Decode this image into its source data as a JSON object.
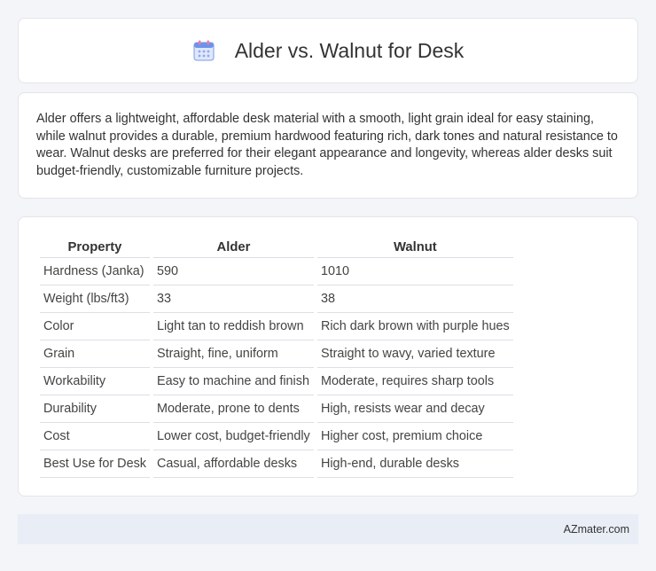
{
  "header": {
    "title": "Alder vs. Walnut for Desk",
    "icon": "calendar-icon"
  },
  "intro": {
    "text": "Alder offers a lightweight, affordable desk material with a smooth, light grain ideal for easy staining, while walnut provides a durable, premium hardwood featuring rich, dark tones and natural resistance to wear. Walnut desks are preferred for their elegant appearance and longevity, whereas alder desks suit budget-friendly, customizable furniture projects."
  },
  "table": {
    "headers": [
      "Property",
      "Alder",
      "Walnut"
    ],
    "rows": [
      [
        "Hardness (Janka)",
        "590",
        "1010"
      ],
      [
        "Weight (lbs/ft3)",
        "33",
        "38"
      ],
      [
        "Color",
        "Light tan to reddish brown",
        "Rich dark brown with purple hues"
      ],
      [
        "Grain",
        "Straight, fine, uniform",
        "Straight to wavy, varied texture"
      ],
      [
        "Workability",
        "Easy to machine and finish",
        "Moderate, requires sharp tools"
      ],
      [
        "Durability",
        "Moderate, prone to dents",
        "High, resists wear and decay"
      ],
      [
        "Cost",
        "Lower cost, budget-friendly",
        "Higher cost, premium choice"
      ],
      [
        "Best Use for Desk",
        "Casual, affordable desks",
        "High-end, durable desks"
      ]
    ]
  },
  "footer": {
    "text": "AZmater.com"
  },
  "colors": {
    "background": "#f3f5f9",
    "card": "#ffffff",
    "footer": "#e8edf6",
    "icon_blue": "#5b8def",
    "icon_pink": "#f07aa0"
  }
}
